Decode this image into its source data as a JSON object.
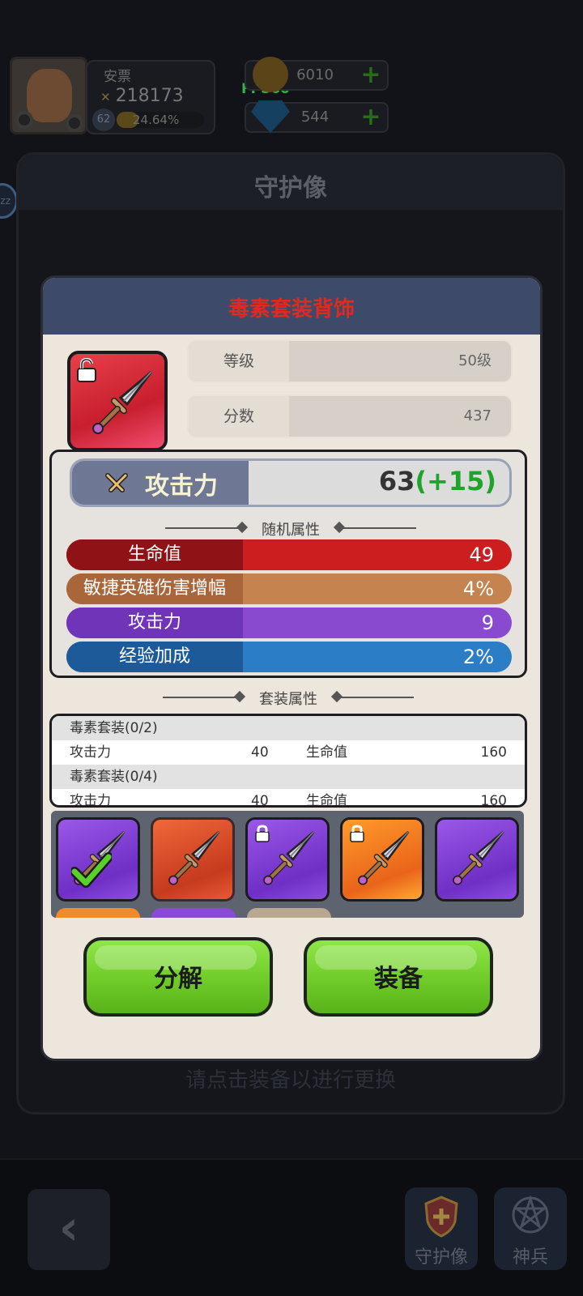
{
  "header": {
    "player_name": "安票",
    "power": "218173",
    "level": "62",
    "xp_percent": "24.64%",
    "xp_fill": 0.2464,
    "fps": "FPS60",
    "gold": "6010",
    "gems": "544"
  },
  "main_panel": {
    "title": "守护像",
    "hint": "请点击装备以进行更换",
    "side_bubble": "zz"
  },
  "item": {
    "title": "毒素套装背饰",
    "level_label": "等级",
    "level_value": "50级",
    "score_label": "分数",
    "score_value": "437",
    "main_attr_name": "攻击力",
    "main_attr_value": "63",
    "main_attr_bonus": "(+15)",
    "random_title": "随机属性",
    "random_stats": [
      {
        "label": "生命值",
        "value": "49",
        "color_label": "#8f1216",
        "color_bar": "#cc1d1f"
      },
      {
        "label": "敏捷英雄伤害增幅",
        "value": "4%",
        "color_label": "#a9663a",
        "color_bar": "#c4834f"
      },
      {
        "label": "攻击力",
        "value": "9",
        "color_label": "#6f34b8",
        "color_bar": "#8a4acf"
      },
      {
        "label": "经验加成",
        "value": "2%",
        "color_label": "#1d5a99",
        "color_bar": "#2b7dc5"
      }
    ],
    "set_title": "套装属性",
    "set_rows": [
      {
        "name": "毒素套装(0/2)"
      },
      {
        "k1": "攻击力",
        "v1": "40",
        "k2": "生命值",
        "v2": "160"
      },
      {
        "name": "毒素套装(0/4)"
      },
      {
        "k1": "攻击力",
        "v1": "40",
        "k2": "生命值",
        "v2": "160"
      }
    ]
  },
  "inventory": [
    {
      "color": "purple",
      "icon": "dagger-icon",
      "equipped": true,
      "locked": false
    },
    {
      "color": "red",
      "icon": "dagger-icon",
      "equipped": false,
      "locked": false
    },
    {
      "color": "purple",
      "icon": "dagger-icon",
      "equipped": false,
      "locked": true
    },
    {
      "color": "orange",
      "icon": "dagger-icon",
      "equipped": false,
      "locked": true
    },
    {
      "color": "purple",
      "icon": "dagger-icon",
      "equipped": false,
      "locked": false
    }
  ],
  "buttons": {
    "decompose": "分解",
    "equip": "装备"
  },
  "nav": {
    "back_icon": "chevron-left-icon",
    "guardian": "守护像",
    "divine": "神兵"
  }
}
